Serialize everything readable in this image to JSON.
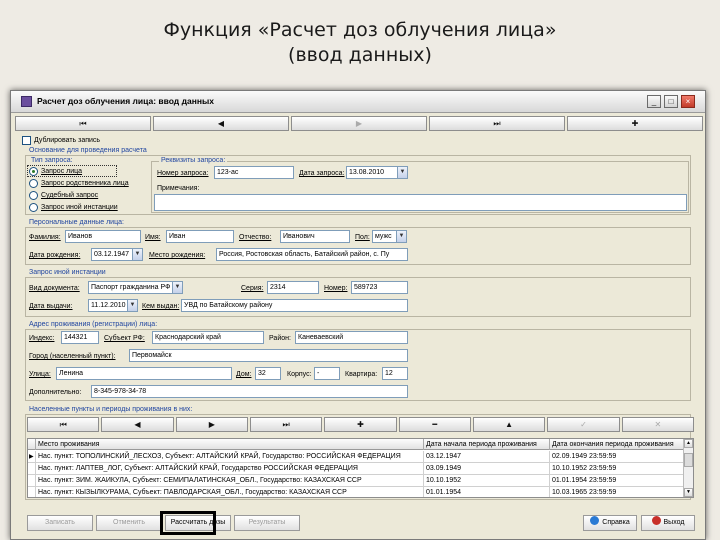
{
  "slide": {
    "title_line1": "Функция «Расчет доз облучения лица»",
    "title_line2": "(ввод данных)"
  },
  "window": {
    "title": "Расчет доз облучения лица: ввод данных",
    "minimize": "_",
    "maximize": "□",
    "close": "×"
  },
  "nav": {
    "first": "⏮",
    "prev": "◀",
    "next": "▶",
    "last": "⏭",
    "add": "✚"
  },
  "duplicate_label": "Дублировать запись",
  "basis": {
    "section_title": "Основание для проведения расчета",
    "type_group_title": "Тип запроса:",
    "types": [
      "Запрос лица",
      "Запрос родственника лица",
      "Судебный запрос",
      "Запрос иной инстанции"
    ],
    "details_group_title": "Реквизиты запроса:",
    "number_label": "Номер запроса:",
    "number_value": "123-ас",
    "date_label": "Дата запроса:",
    "date_value": "13.08.2010",
    "notes_label": "Примечания:",
    "notes_value": ""
  },
  "personal": {
    "section_title": "Персональные данные лица:",
    "surname_label": "Фамилия:",
    "surname_value": "Иванов",
    "name_label": "Имя:",
    "name_value": "Иван",
    "patronymic_label": "Отчество:",
    "patronymic_value": "Иванович",
    "sex_label": "Пол:",
    "sex_value": "мужс",
    "birthdate_label": "Дата рождения:",
    "birthdate_value": "03.12.1947",
    "birthplace_label": "Место рождения:",
    "birthplace_value": "Россия, Ростовская область, Батайский район, с. Пу"
  },
  "other_request": {
    "section_title": "Запрос иной инстанции",
    "doc_type_label": "Вид документа:",
    "doc_type_value": "Паспорт гражданина РФ",
    "series_label": "Серия:",
    "series_value": "2314",
    "number_label": "Номер:",
    "number_value": "589723",
    "issue_date_label": "Дата выдачи:",
    "issue_date_value": "11.12.2010",
    "issued_by_label": "Кем выдан:",
    "issued_by_value": "УВД по Батайскому району"
  },
  "address": {
    "section_title": "Адрес проживания (регистрации) лица:",
    "index_label": "Индекс:",
    "index_value": "144321",
    "region_label": "Субъект РФ:",
    "region_value": "Краснодарский край",
    "district_label": "Район:",
    "district_value": "Каневаевский",
    "city_label": "Город (населенный пункт):",
    "city_value": "Первомайск",
    "street_label": "Улица:",
    "street_value": "Ленина",
    "house_label": "Дом:",
    "house_value": "32",
    "building_label": "Корпус:",
    "building_value": "-",
    "flat_label": "Квартира:",
    "flat_value": "12",
    "extra_label": "Дополнительно:",
    "extra_value": "8-345-978-34-78"
  },
  "settlements": {
    "section_title": "Населенные пункты и периоды проживания в них:",
    "toolbar": [
      "⏮",
      "◀",
      "▶",
      "⏭",
      "✚",
      "━",
      "▲",
      "✓",
      "✕"
    ],
    "columns": [
      "Место проживания",
      "Дата начала периода проживания",
      "Дата окончания периода проживания"
    ],
    "rows": [
      {
        "place": "Нас. пункт: ТОПОЛИНСКИЙ_ЛЕСХОЗ, Субъект: АЛТАЙСКИЙ КРАЙ, Государство: РОССИЙСКАЯ ФЕДЕРАЦИЯ",
        "start": "03.12.1947",
        "end": "02.09.1949 23:59:59",
        "current": true
      },
      {
        "place": "Нас. пункт: ЛАПТЕВ_ЛОГ, Субъект: АЛТАЙСКИЙ КРАЙ, Государство РОССИЙСКАЯ ФЕДЕРАЦИЯ",
        "start": "03.09.1949",
        "end": "10.10.1952 23:59:59",
        "current": false
      },
      {
        "place": "Нас. пункт: ЗИМ. ЖАИКУЛА, Субъект: СЕМИПАЛАТИНСКАЯ_ОБЛ., Государство: КАЗАХСКАЯ ССР",
        "start": "10.10.1952",
        "end": "01.01.1954 23:59:59",
        "current": false
      },
      {
        "place": "Нас. пункт: КЫЗЫЛКУРАМА, Субъект: ПАВЛОДАРСКАЯ_ОБЛ., Государство: КАЗАХСКАЯ ССР",
        "start": "01.01.1954",
        "end": "10.03.1965 23:59:59",
        "current": false
      }
    ]
  },
  "footer": {
    "save": "Записать",
    "cancel": "Отменить",
    "calculate": "Рассчитать дозы",
    "results": "Результаты",
    "help": "Справка",
    "exit": "Выход"
  }
}
